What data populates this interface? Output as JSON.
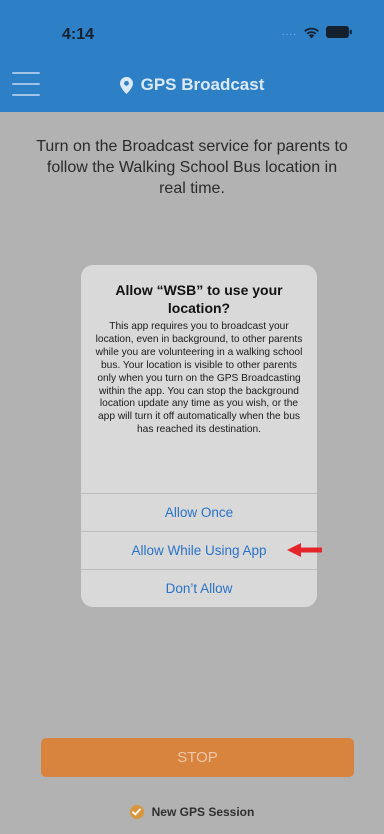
{
  "status_bar": {
    "time": "4:14",
    "signal_dots": "....",
    "icons": [
      "wifi-icon",
      "battery-icon"
    ]
  },
  "nav": {
    "menu_icon": "hamburger-menu-icon",
    "title_icon": "location-pin-icon",
    "title": "GPS Broadcast"
  },
  "intro_text": "Turn on the Broadcast service for parents to follow the Walking School Bus location in real time.",
  "alert": {
    "title": "Allow “WSB” to use your location?",
    "message": "This app requires you to broadcast your location, even in background, to other parents while you are volunteering in a walking school bus. Your location is visible to other parents only when you turn on the GPS Broadcasting within the app. You can stop the background location update any time as you wish, or the app will turn it off automatically when the bus has reached its destination.",
    "buttons": [
      "Allow Once",
      "Allow While Using App",
      "Don’t Allow"
    ]
  },
  "annotation_arrow_color": "#e5252a",
  "stop_button": {
    "label": "STOP"
  },
  "session": {
    "icon": "check-circle-icon",
    "label": "New GPS Session"
  },
  "colors": {
    "header": "#2d7fc6",
    "overlay_background": "#b2b2b2",
    "alert_background": "#d9d9d9",
    "alert_button_text": "#2a72c8",
    "stop_button": "#d9843e",
    "session_icon": "#d9963e"
  }
}
